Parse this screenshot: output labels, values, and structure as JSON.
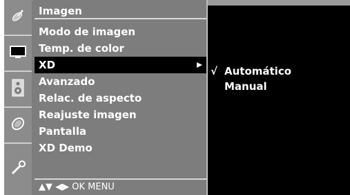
{
  "menu": {
    "title": "Imagen",
    "items": [
      {
        "label": "Modo de imagen",
        "selected": false
      },
      {
        "label": "Temp. de color",
        "selected": false
      },
      {
        "label": "XD",
        "selected": true
      },
      {
        "label": "Avanzado",
        "selected": false
      },
      {
        "label": "Relac. de aspecto",
        "selected": false
      },
      {
        "label": "Reajuste imagen",
        "selected": false
      },
      {
        "label": "Pantalla",
        "selected": false
      },
      {
        "label": "XD Demo",
        "selected": false
      }
    ],
    "footer": "▲▼ ◀▶ OK MENU"
  },
  "submenu": {
    "check_mark": "√",
    "items": [
      {
        "label": "Automático",
        "checked": true
      },
      {
        "label": "Manual",
        "checked": false
      }
    ]
  },
  "icons": [
    "satellite-dish-icon",
    "picture-icon",
    "speaker-icon",
    "clock-icon",
    "settings-icon"
  ]
}
